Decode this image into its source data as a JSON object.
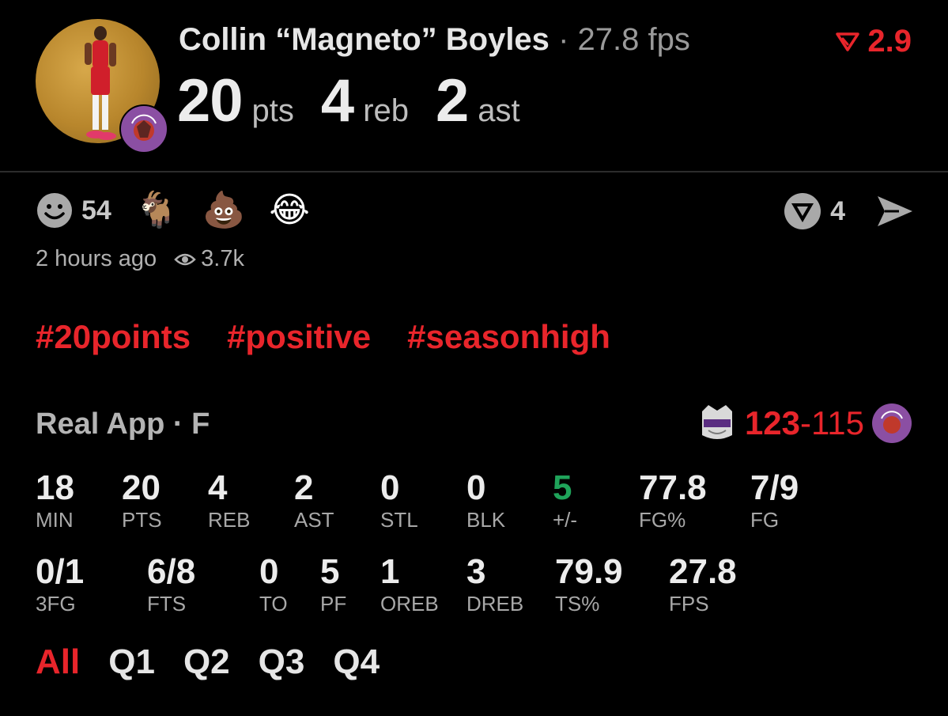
{
  "player": {
    "name": "Collin “Magneto” Boyles",
    "separator": "·",
    "fps": "27.8 fps",
    "trend_value": "2.9"
  },
  "headline": [
    {
      "value": "20",
      "unit": "pts"
    },
    {
      "value": "4",
      "unit": "reb"
    },
    {
      "value": "2",
      "unit": "ast"
    }
  ],
  "reactions": {
    "smile_count": "54",
    "comment_count": "4"
  },
  "meta": {
    "time_ago": "2 hours ago",
    "views": "3.7k"
  },
  "tags": [
    "#20points",
    "#positive",
    "#seasonhigh"
  ],
  "game": {
    "source": "Real App",
    "position": "F",
    "score_winner": "123",
    "score_sep": "-",
    "score_loser": "115"
  },
  "stats_row1": [
    {
      "value": "18",
      "label": "MIN"
    },
    {
      "value": "20",
      "label": "PTS"
    },
    {
      "value": "4",
      "label": "REB"
    },
    {
      "value": "2",
      "label": "AST"
    },
    {
      "value": "0",
      "label": "STL"
    },
    {
      "value": "0",
      "label": "BLK"
    },
    {
      "value": "5",
      "label": "+/-",
      "color": "#1fa35a"
    },
    {
      "value": "77.8",
      "label": "FG%"
    },
    {
      "value": "7/9",
      "label": "FG"
    }
  ],
  "stats_row2": [
    {
      "value": "0/1",
      "label": "3FG"
    },
    {
      "value": "6/8",
      "label": "FTS"
    },
    {
      "value": "0",
      "label": "TO"
    },
    {
      "value": "5",
      "label": "PF"
    },
    {
      "value": "1",
      "label": "OREB"
    },
    {
      "value": "3",
      "label": "DREB"
    },
    {
      "value": "79.9",
      "label": "TS%"
    },
    {
      "value": "27.8",
      "label": "FPS"
    }
  ],
  "quarters": [
    "All",
    "Q1",
    "Q2",
    "Q3",
    "Q4"
  ],
  "colors": {
    "accent": "#e8252b",
    "positive": "#1fa35a",
    "raptors": "#8b4fa3"
  }
}
